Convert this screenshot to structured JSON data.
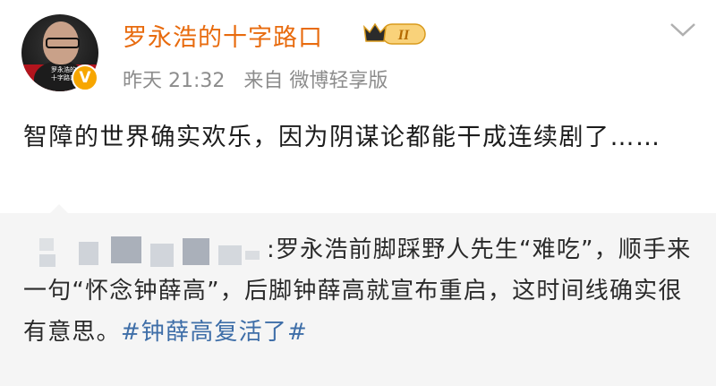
{
  "post": {
    "author": "罗永浩的十字路口",
    "avatar_caption": "罗永浩的十字路口",
    "verified_glyph": "V",
    "level_badge": "II",
    "time": "昨天 21:32",
    "source": "来自 微博轻享版",
    "text": "智障的世界确实欢乐，因为阴谋论都能干成连续剧了……"
  },
  "repost": {
    "text_before": ":罗永浩前脚踩野人先生“难吃”，顺手来一句“怀念钟薛高”，后脚钟薛高就宣布重启，这时间线确实很有意思。",
    "hashtag": "#钟薛高复活了#"
  },
  "colors": {
    "username": "#e86b0e",
    "meta": "#8c8c8c",
    "hashtag": "#3e6ea8",
    "repost_bg": "#f5f5f5"
  },
  "icons": {
    "verified": "verified-badge-icon",
    "crown": "crown-level-icon",
    "menu": "chevron-down-icon"
  }
}
